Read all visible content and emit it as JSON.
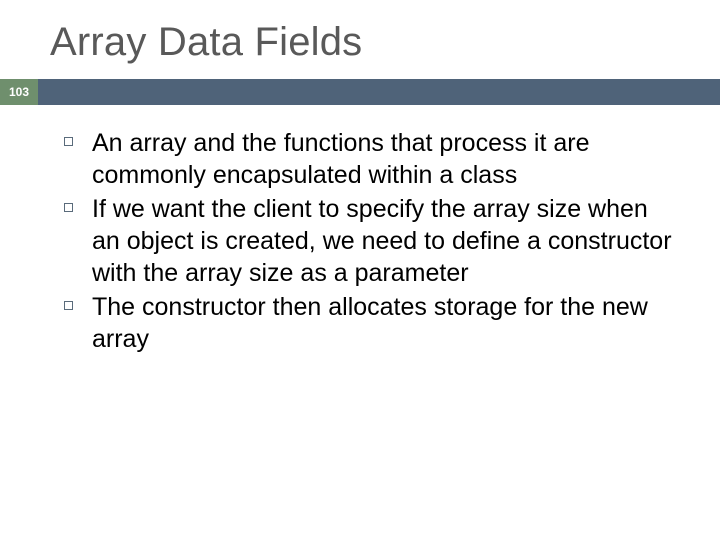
{
  "slide": {
    "title": "Array Data Fields",
    "page_number": "103",
    "bullets": [
      "An array and the functions that process it are commonly encapsulated within a class",
      "If we want the client to specify the array size when an object is created, we need to define a constructor with the array size as a parameter",
      "The constructor then allocates storage for the new array"
    ]
  }
}
